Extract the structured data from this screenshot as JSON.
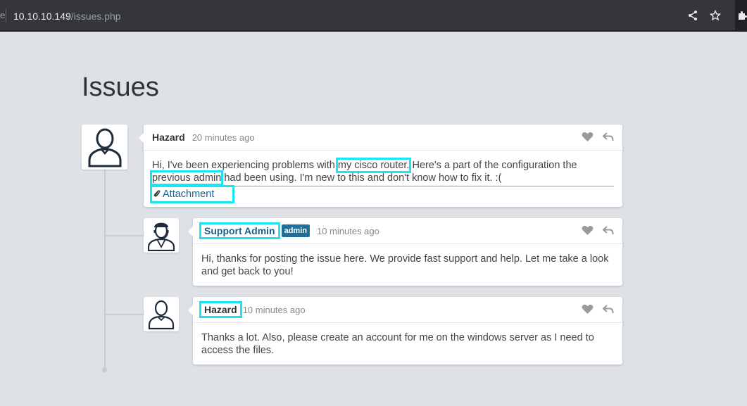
{
  "browser": {
    "url_host": "10.10.10.149",
    "url_path": "/issues.php",
    "left_glyph": "e"
  },
  "page": {
    "title": "Issues"
  },
  "posts": [
    {
      "author": "Hazard",
      "time": "20 minutes ago",
      "text_before": "Hi, I've been experiencing problems with ",
      "highlight_1": "my cisco router.",
      "text_middle": " Here's a part of the configuration the ",
      "highlight_2": "previous admin",
      "text_after": " had been using. I'm new to this and don't know how to fix it. :(",
      "attachment_label": "Attachment"
    },
    {
      "author": "Support Admin",
      "badge": "admin",
      "time": "10 minutes ago",
      "text": "Hi, thanks for posting the issue here. We provide fast support and help. Let me take a look and get back to you!"
    },
    {
      "author": "Hazard",
      "time": "10 minutes ago",
      "text": "Thanks a lot. Also, please create an account for me on the windows server as I need to access the files."
    }
  ],
  "icons": {
    "like": "heart-icon",
    "reply": "reply-icon",
    "attachment": "paperclip-icon",
    "avatar_user": "user-avatar-icon",
    "avatar_support": "support-agent-avatar-icon"
  },
  "colors": {
    "highlight": "#19e6f2",
    "badge": "#1f6f99",
    "link": "#1a5f8a"
  }
}
